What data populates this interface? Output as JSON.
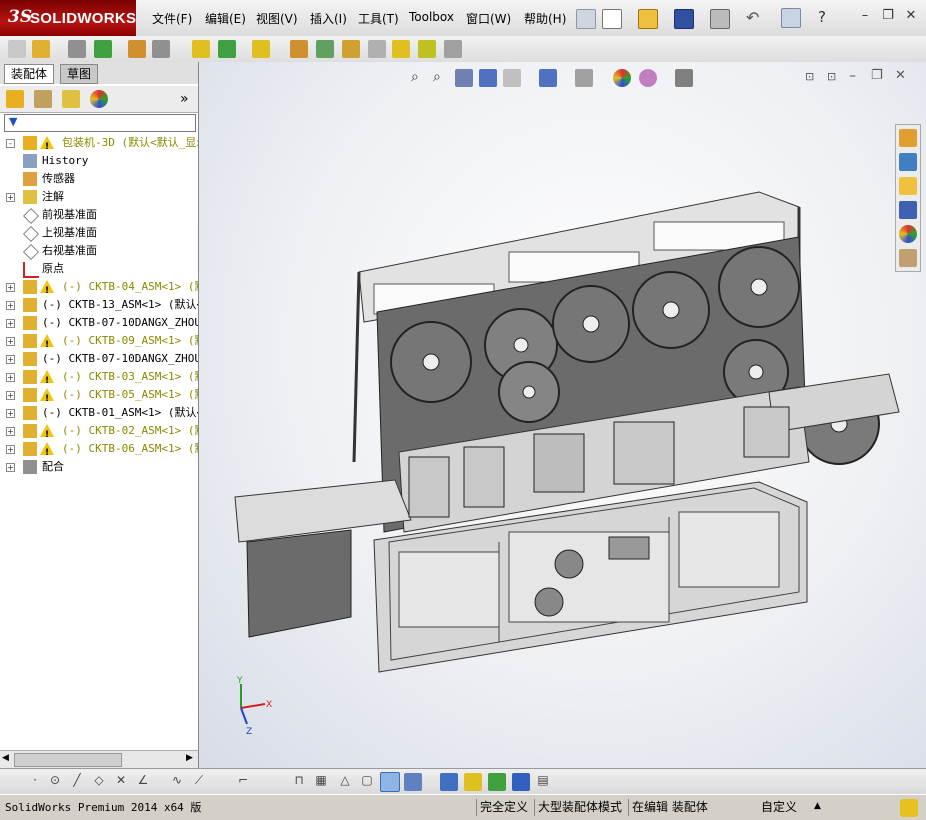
{
  "app": {
    "logo_prefix": "3S",
    "logo_name": "SOLIDWORKS"
  },
  "menu": [
    {
      "label": "文件(F)"
    },
    {
      "label": "编辑(E)"
    },
    {
      "label": "视图(V)"
    },
    {
      "label": "插入(I)"
    },
    {
      "label": "工具(T)"
    },
    {
      "label": "Toolbox"
    },
    {
      "label": "窗口(W)"
    },
    {
      "label": "帮助(H)"
    }
  ],
  "tabs": [
    {
      "label": "装配体"
    },
    {
      "label": "草图"
    }
  ],
  "tree": [
    {
      "label": "包装机-3D  (默认<默认_显示",
      "warn": true,
      "exp": "-",
      "icon": "assembly-root-icon"
    },
    {
      "label": "History",
      "warn": false,
      "exp": "",
      "icon": "history-icon"
    },
    {
      "label": "传感器",
      "warn": false,
      "exp": "",
      "icon": "sensor-icon"
    },
    {
      "label": "注解",
      "warn": false,
      "exp": "+",
      "icon": "annotation-icon"
    },
    {
      "label": "前视基准面",
      "warn": false,
      "exp": "",
      "icon": "plane-icon"
    },
    {
      "label": "上视基准面",
      "warn": false,
      "exp": "",
      "icon": "plane-icon"
    },
    {
      "label": "右视基准面",
      "warn": false,
      "exp": "",
      "icon": "plane-icon"
    },
    {
      "label": "原点",
      "warn": false,
      "exp": "",
      "icon": "origin-icon"
    },
    {
      "label": "(-) CKTB-04_ASM<1> (默认",
      "warn": true,
      "exp": "+",
      "icon": "subassembly-icon"
    },
    {
      "label": "(-) CKTB-13_ASM<1> (默认<",
      "warn": false,
      "exp": "+",
      "icon": "subassembly-icon"
    },
    {
      "label": "(-) CKTB-07-10DANGX_ZHOUCH",
      "warn": false,
      "exp": "+",
      "icon": "subassembly-icon"
    },
    {
      "label": "(-) CKTB-09_ASM<1> (默认",
      "warn": true,
      "exp": "+",
      "icon": "subassembly-icon"
    },
    {
      "label": "(-) CKTB-07-10DANGX_ZHOUCH",
      "warn": false,
      "exp": "+",
      "icon": "subassembly-icon"
    },
    {
      "label": "(-) CKTB-03_ASM<1> (默认",
      "warn": true,
      "exp": "+",
      "icon": "subassembly-icon"
    },
    {
      "label": "(-) CKTB-05_ASM<1> (默认",
      "warn": true,
      "exp": "+",
      "icon": "subassembly-icon"
    },
    {
      "label": "(-) CKTB-01_ASM<1> (默认<",
      "warn": false,
      "exp": "+",
      "icon": "subassembly-icon"
    },
    {
      "label": "(-) CKTB-02_ASM<1> (默认",
      "warn": true,
      "exp": "+",
      "icon": "subassembly-icon"
    },
    {
      "label": "(-) CKTB-06_ASM<1> (默认",
      "warn": true,
      "exp": "+",
      "icon": "subassembly-icon"
    },
    {
      "label": "配合",
      "warn": false,
      "exp": "+",
      "icon": "mates-icon"
    }
  ],
  "status": {
    "app_version": "SolidWorks Premium 2014 x64 版",
    "fully_defined": "完全定义",
    "large_assembly": "大型装配体模式",
    "editing": "在编辑 装配体",
    "custom": "自定义"
  },
  "triad": {
    "x": "X",
    "y": "Y",
    "z": "Z"
  },
  "colors": {
    "logo_red": "#a50e0e",
    "frame": "#d8d8d8",
    "panel": "#6b6b6b",
    "warn": "#f1c40f"
  }
}
